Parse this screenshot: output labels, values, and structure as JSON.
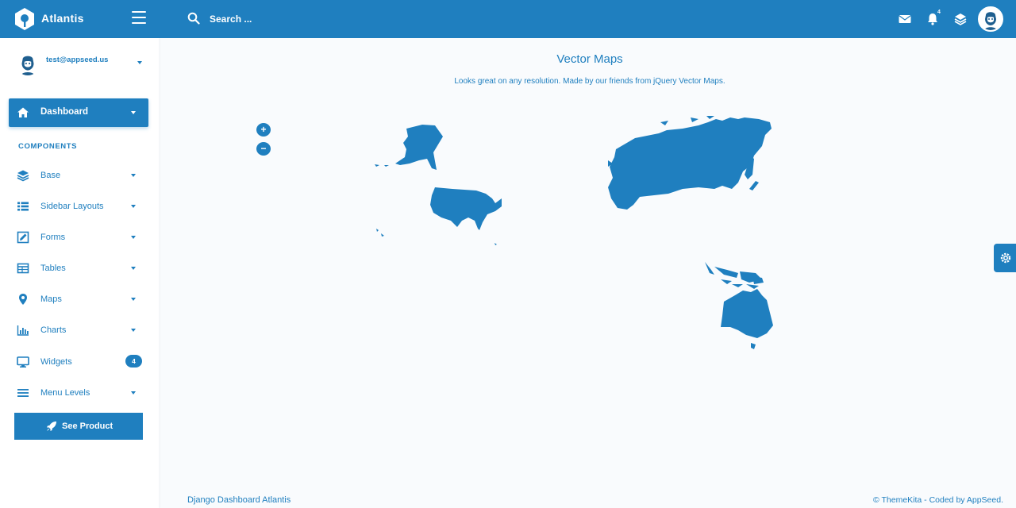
{
  "header": {
    "brand": "Atlantis",
    "search_placeholder": "Search ...",
    "notification_count": "4",
    "icons": [
      "hamburger-icon",
      "search-icon",
      "envelope-icon",
      "bell-icon",
      "layers-icon",
      "user-avatar"
    ]
  },
  "sidebar": {
    "user_email": "test@appseed.us",
    "dashboard_label": "Dashboard",
    "section_title": "COMPONENTS",
    "items": [
      {
        "label": "Base",
        "icon": "layers-icon"
      },
      {
        "label": "Sidebar Layouts",
        "icon": "list-icon"
      },
      {
        "label": "Forms",
        "icon": "pen-square-icon"
      },
      {
        "label": "Tables",
        "icon": "table-icon"
      },
      {
        "label": "Maps",
        "icon": "map-marker-icon"
      },
      {
        "label": "Charts",
        "icon": "bar-chart-icon"
      },
      {
        "label": "Widgets",
        "icon": "desktop-icon",
        "badge": "4"
      },
      {
        "label": "Menu Levels",
        "icon": "bars-icon"
      }
    ],
    "see_product_label": "See Product"
  },
  "main": {
    "title": "Vector Maps",
    "subtitle": "Looks great on any resolution. Made by our friends from jQuery Vector Maps.",
    "zoom_in": "+",
    "zoom_out": "−",
    "highlighted_regions": [
      "United States",
      "Russia",
      "Australia",
      "Indonesia"
    ]
  },
  "footer": {
    "left": "Django Dashboard Atlantis",
    "right": "© ThemeKita - Coded by AppSeed."
  },
  "colors": {
    "primary": "#1f7fbf",
    "background": "#f9fbfd"
  }
}
